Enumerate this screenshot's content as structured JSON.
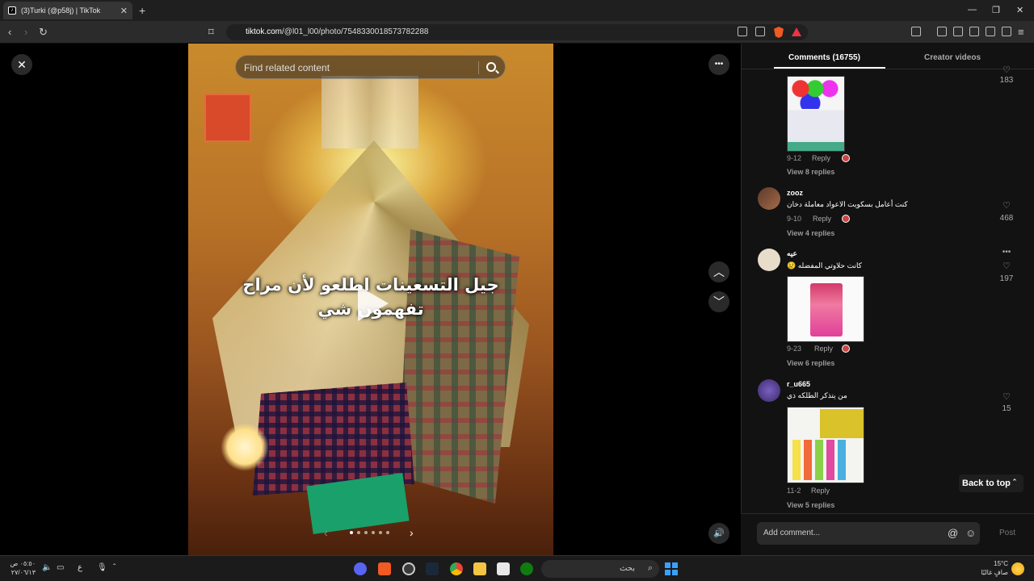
{
  "browser": {
    "tab_title": "(3)Turki (@p58j) | TikTok",
    "new_tab": "+",
    "url_host": "tiktok.com",
    "url_path": "/@l01_l00/photo/7548330018573782288",
    "win_min": "—",
    "win_max": "❐",
    "win_close": "✕"
  },
  "viewer": {
    "search_placeholder": "Find related content",
    "close_glyph": "✕",
    "more_glyph": "•••",
    "up_glyph": "︿",
    "down_glyph": "﹀",
    "volume_glyph": "🔊",
    "caption_line1": "جيل التسعينات اطلعو لأن مراح",
    "caption_line2": "تفهمون شي",
    "prev_glyph": "‹",
    "next_glyph": "›",
    "slide_count": 6,
    "slide_active": 0
  },
  "comments_panel": {
    "tab_comments": "Comments (16755)",
    "tab_creator": "Creator videos",
    "comments": [
      {
        "id": "c0",
        "date": "9-12",
        "reply_label": "Reply",
        "likes": "183",
        "view_replies": "View 8 replies"
      },
      {
        "id": "c1",
        "username": "zooz",
        "text": "كنت أعامل بسكويت الاعواد معاملة دخان",
        "date": "9-10",
        "reply_label": "Reply",
        "likes": "468",
        "view_replies": "View 4 replies"
      },
      {
        "id": "c2",
        "username": "عيه",
        "text": "كانت حلاوتي المفضله 😢",
        "date": "9-23",
        "reply_label": "Reply",
        "likes": "197",
        "view_replies": "View 6 replies"
      },
      {
        "id": "c3",
        "username": "r_u665",
        "text": "من يتذكر الطلكه ذي",
        "date": "11-2",
        "reply_label": "Reply",
        "likes": "15",
        "view_replies": "View 5 replies"
      }
    ],
    "back_to_top": "Back to top",
    "add_comment_placeholder": "Add comment...",
    "post_label": "Post",
    "at_glyph": "@",
    "emoji_glyph": "☺"
  },
  "taskbar": {
    "search_label": "بحث",
    "clock_time": "٠٥:٥٠ ص",
    "clock_date": "٢٧/٠٦/١٣",
    "weather_temp": "15°C",
    "weather_desc": "صافٍ غالبًا"
  },
  "colors": {
    "panel_bg": "#121212",
    "accent_red": "#fe2c55"
  }
}
